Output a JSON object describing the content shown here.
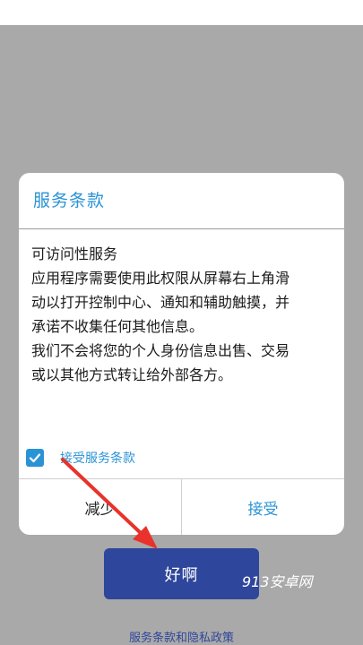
{
  "dialog": {
    "title": "服务条款",
    "body_lines": [
      "可访问性服务",
      "应用程序需要使用此权限从屏幕右上角滑",
      "动以打开控制中心、通知和辅助触摸，并",
      "承诺不收集任何其他信息。",
      "我们不会将您的个人身份信息出售、交易",
      "或以其他方式转让给外部各方。"
    ],
    "checkbox": {
      "label": "接受服务条款",
      "checked": true
    },
    "cancel_label": "减少",
    "accept_label": "接受"
  },
  "okay_button_label": "好啊",
  "watermark_text": "913安卓网",
  "policy_link_text": "服务条款和隐私政策",
  "colors": {
    "accent": "#2a93d5",
    "primary_button": "#2e469b",
    "backdrop": "#a9a9a9",
    "arrow": "#e8322b"
  }
}
